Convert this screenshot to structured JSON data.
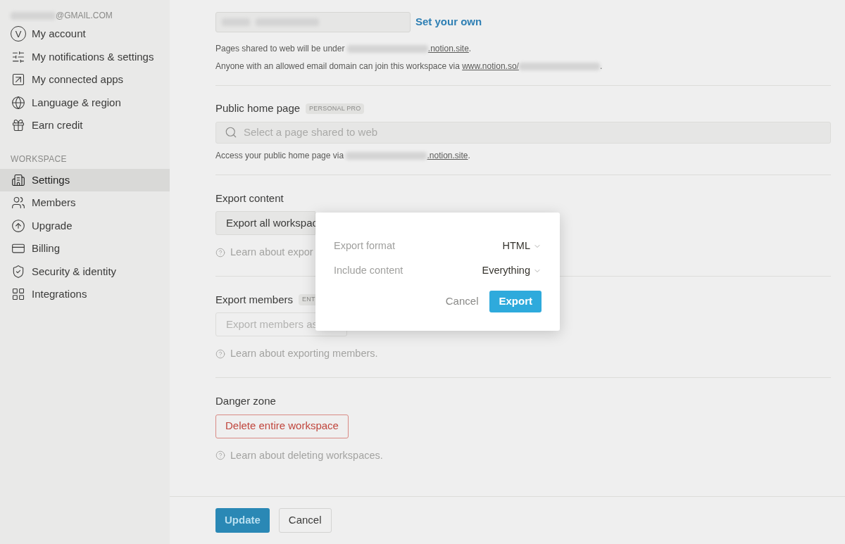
{
  "sidebar": {
    "account_email": "@GMAIL.COM",
    "account_items": [
      {
        "label": "My account",
        "avatar_letter": "V",
        "selected": false
      },
      {
        "label": "My notifications & settings",
        "selected": false
      },
      {
        "label": "My connected apps",
        "selected": false
      },
      {
        "label": "Language & region",
        "selected": false
      },
      {
        "label": "Earn credit",
        "selected": false
      }
    ],
    "workspace_heading": "WORKSPACE",
    "workspace_items": [
      {
        "label": "Settings",
        "selected": true
      },
      {
        "label": "Members",
        "selected": false
      },
      {
        "label": "Upgrade",
        "selected": false
      },
      {
        "label": "Billing",
        "selected": false
      },
      {
        "label": "Security & identity",
        "selected": false
      },
      {
        "label": "Integrations",
        "selected": false
      }
    ]
  },
  "domain": {
    "set_own_link": "Set your own",
    "caption_1": {
      "text": "Pages shared to web will be under",
      "link": ".notion.site",
      "end": "."
    },
    "caption_2": {
      "text": "Anyone with an allowed email domain can join this workspace via",
      "link": "www.notion.so/",
      "end": "."
    }
  },
  "public_home": {
    "title": "Public home page",
    "badge": "PERSONAL PRO",
    "placeholder": "Select a page shared to web",
    "caption": {
      "text": "Access your public home page via",
      "link": ".notion.site",
      "end": "."
    }
  },
  "export_content": {
    "title": "Export content",
    "button": "Export all workspac",
    "help": "Learn about expor"
  },
  "export_members": {
    "title": "Export members",
    "badge": "ENT",
    "placeholder": "Export members as",
    "help": "Learn about exporting members."
  },
  "danger_zone": {
    "title": "Danger zone",
    "button": "Delete entire workspace",
    "help": "Learn about deleting workspaces."
  },
  "footer": {
    "primary": "Update",
    "secondary": "Cancel"
  },
  "dialog": {
    "rows": [
      {
        "label": "Export format",
        "value": "HTML"
      },
      {
        "label": "Include content",
        "value": "Everything"
      }
    ],
    "cancel": "Cancel",
    "confirm": "Export"
  }
}
